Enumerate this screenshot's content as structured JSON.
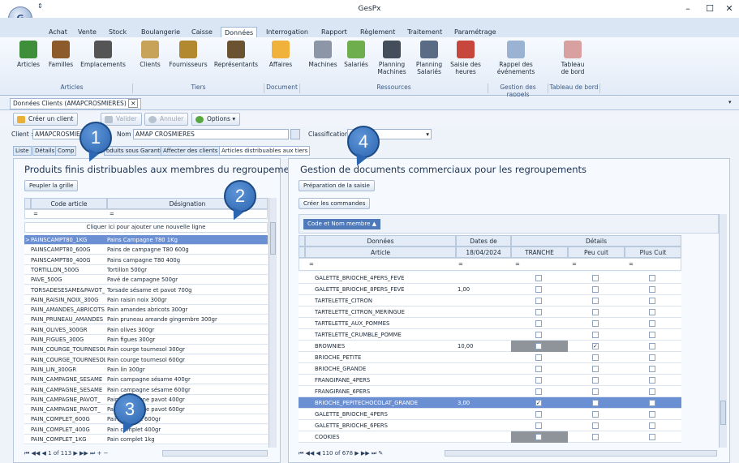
{
  "window": {
    "title": "GesPx",
    "minimize": "–",
    "maximize": "☐",
    "close": "✕",
    "logo": "G"
  },
  "menus": [
    "Achat",
    "Vente",
    "Stock",
    "Boulangerie",
    "Caisse",
    "Données",
    "Interrogation",
    "Rapport",
    "Règlement",
    "Traitement",
    "Paramétrage"
  ],
  "ribbon": {
    "buttons": [
      "Articles",
      "Familles",
      "Emplacements",
      "Clients",
      "Fournisseurs",
      "Représentants",
      "Affaires",
      "Machines",
      "Salariés",
      "Planning\nMachines",
      "Planning\nSalariés",
      "Saisie des\nheures",
      "Rappel des\névénements",
      "Tableau\nde bord"
    ],
    "groups": [
      "Articles",
      "Tiers",
      "Document",
      "Ressources",
      "Gestion des rappels",
      "Tableau de bord"
    ]
  },
  "doctab": {
    "label": "Données Clients (AMAPCROSMIERES)",
    "close": "✕"
  },
  "toolbar": {
    "create": "Créer un client",
    "validate": "Valider",
    "cancel": "Annuler",
    "options": "Options"
  },
  "client": {
    "label": "Client :",
    "code": "AMAPCROSMIE",
    "nom_label": "Nom :",
    "nom": "AMAP CROSMIERES",
    "class_label": "Classification",
    "class_value": "el"
  },
  "subtabs": [
    "Liste",
    "Détails",
    "Comp",
    "oduits sous Garantie",
    "Affecter des clients",
    "Articles distribuables aux tiers"
  ],
  "left": {
    "title": "Produits finis distribuables aux membres du regroupement",
    "populate": "Peupler la grille",
    "col1": "Code article",
    "col2": "Désignation",
    "filter": "=",
    "newrow": "Cliquer ici pour ajouter une nouvelle ligne",
    "nav": "1 of 113",
    "rows": [
      [
        "PAINSCAMPT80_1KG",
        "Pains Campagne T80 1Kg"
      ],
      [
        "PAINSCAMPT80_600G",
        "Pains de campagne T80 600g"
      ],
      [
        "PAINSCAMPT80_400G",
        "Pains campagne T80 400g"
      ],
      [
        "TORTILLON_500G",
        "Tortillon 500gr"
      ],
      [
        "PAVE_500G",
        "Pavé de campagne 500gr"
      ],
      [
        "TORSADESESAME&PAVOT_",
        "Torsade sésame et pavot 700g"
      ],
      [
        "PAIN_RAISIN_NOIX_300G",
        "Pain raisin noix 300gr"
      ],
      [
        "PAIN_AMANDES_ABRICOTS",
        "Pain amandes abricots 300gr"
      ],
      [
        "PAIN_PRUNEAU_AMANDES",
        "Pain pruneau amande gingembre 300gr"
      ],
      [
        "PAIN_OLIVES_300GR",
        "Pain olives 300gr"
      ],
      [
        "PAIN_FIGUES_300G",
        "Pain figues 300gr"
      ],
      [
        "PAIN_COURGE_TOURNESOL",
        "Pain courge tournesol 300gr"
      ],
      [
        "PAIN_COURGE_TOURNESOL",
        "Pain courge tournesol 600gr"
      ],
      [
        "PAIN_LIN_300GR",
        "Pain lin 300gr"
      ],
      [
        "PAIN_CAMPAGNE_SESAME",
        "Pain campagne sésame 400gr"
      ],
      [
        "PAIN_CAMPAGNE_SESAME",
        "Pain campagne sésame 600gr"
      ],
      [
        "PAIN_CAMPAGNE_PAVOT_",
        "Pain campagne pavot 400gr"
      ],
      [
        "PAIN_CAMPAGNE_PAVOT_",
        "Pain campagne pavot 600gr"
      ],
      [
        "PAIN_COMPLET_600G",
        "Pain complet 600gr"
      ],
      [
        "PAIN_COMPLET_400G",
        "Pain complet 400gr"
      ],
      [
        "PAIN_COMPLET_1KG",
        "Pain complet 1kg"
      ]
    ]
  },
  "right": {
    "title": "Gestion de documents commerciaux pour les regroupements",
    "prep": "Préparation de la saisie",
    "create": "Créer les commandes",
    "groupby": "Code et Nom membre ▲",
    "h_donnees": "Données",
    "h_dates": "Dates de livraison",
    "h_details": "Détails",
    "h_article": "Article",
    "h_date": "18/04/2024",
    "h_tranche": "TRANCHE",
    "h_peu": "Peu cuit",
    "h_plus": "Plus Cuit",
    "filter": "=",
    "nav": "110 of 678",
    "rows": [
      {
        "a": "GALETTE_BRIOCHE_4PERS_FEVE",
        "q": ""
      },
      {
        "a": "GALETTE_BRIOCHE_8PERS_FEVE",
        "q": "1,00"
      },
      {
        "a": "TARTELETTE_CITRON",
        "q": ""
      },
      {
        "a": "TARTELETTE_CITRON_MERINGUE",
        "q": ""
      },
      {
        "a": "TARTELETTE_AUX_POMMES",
        "q": ""
      },
      {
        "a": "TARTELETTE_CRUMBLE_POMME",
        "q": ""
      },
      {
        "a": "BROWNIES",
        "q": "10,00"
      },
      {
        "a": "BRIOCHE_PETITE",
        "q": ""
      },
      {
        "a": "BRIOCHE_GRANDE",
        "q": ""
      },
      {
        "a": "FRANGIPANE_4PERS",
        "q": ""
      },
      {
        "a": "FRANGIPANE_6PERS",
        "q": ""
      },
      {
        "a": "BRIOCHE_PEPITECHOCOLAT_GRANDE",
        "q": "3,00"
      },
      {
        "a": "GALETTE_BRIOCHE_4PERS",
        "q": ""
      },
      {
        "a": "GALETTE_BRIOCHE_6PERS",
        "q": ""
      },
      {
        "a": "COOKIES",
        "q": ""
      }
    ]
  },
  "callouts": [
    "1",
    "2",
    "3",
    "4"
  ]
}
